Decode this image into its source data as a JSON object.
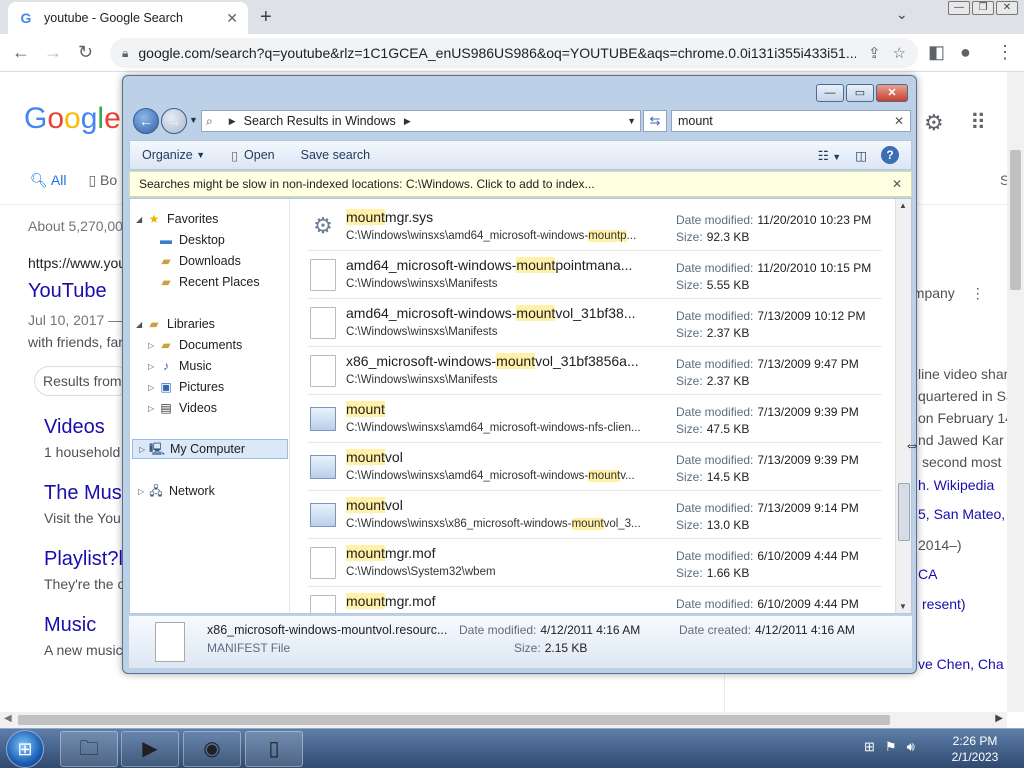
{
  "browser": {
    "tab_title": "youtube - Google Search",
    "tab_favicon": "G",
    "url": "google.com/search?q=youtube&rlz=1C1GCEA_enUS986US986&oq=YOUTUBE&aqs=chrome.0.0i131i355i433i51..."
  },
  "google": {
    "logo": "Google",
    "tab_all": "All",
    "tab_books": "Bo",
    "tab_more": "S",
    "stats": "About 5,270,00",
    "result_url": "https://www.you",
    "result_title": "YouTube",
    "result_date": "Jul 10, 2017  —",
    "result_snip": "with friends, far",
    "results_from": "Results from",
    "sub1_title": "Videos",
    "sub1_snip": "1 household",
    "sub2_title": "The Mus",
    "sub2_snip": "Visit the You",
    "sub3_title": "Playlist?l",
    "sub3_snip": "They're the c",
    "sub4_title": "Music",
    "sub4_snip": "A new music",
    "kp_company": "ompany",
    "kp_l1": "line video shar",
    "kp_l2": "quartered in Sa",
    "kp_l3": "on February 14",
    "kp_l4": "nd Jawed Kar",
    "kp_l5": "second most",
    "kp_wiki": "h. Wikipedia",
    "kp_l6": "5, San Mateo,",
    "kp_l7": "2014–)",
    "kp_l8": "CA",
    "kp_l9": "resent)",
    "kp_l10": "ve Chen, Cha"
  },
  "explorer": {
    "breadcrumb": "Search Results in Windows",
    "search_value": "mount",
    "commands": {
      "organize": "Organize",
      "open": "Open",
      "save_search": "Save search"
    },
    "infobar": "Searches might be slow in non-indexed locations: C:\\Windows. Click to add to index...",
    "nav": {
      "favorites": "Favorites",
      "desktop": "Desktop",
      "downloads": "Downloads",
      "recent": "Recent Places",
      "libraries": "Libraries",
      "documents": "Documents",
      "music": "Music",
      "pictures": "Pictures",
      "videos": "Videos",
      "computer": "My Computer",
      "network": "Network"
    },
    "labels": {
      "date_modified": "Date modified:",
      "size": "Size:",
      "date_created": "Date created:"
    },
    "files": [
      {
        "pre": "",
        "hl": "mount",
        "post": "mgr.sys",
        "path_pre": "C:\\Windows\\winsxs\\amd64_microsoft-windows-",
        "path_hl": "mountp",
        "path_post": "...",
        "date": "11/20/2010 10:23 PM",
        "size": "92.3 KB",
        "icon": "gear"
      },
      {
        "pre": "amd64_microsoft-windows-",
        "hl": "mount",
        "post": "pointmana...",
        "path_pre": "C:\\Windows\\winsxs\\Manifests",
        "path_hl": "",
        "path_post": "",
        "date": "11/20/2010 10:15 PM",
        "size": "5.55 KB",
        "icon": "doc"
      },
      {
        "pre": "amd64_microsoft-windows-",
        "hl": "mount",
        "post": "vol_31bf38...",
        "path_pre": "C:\\Windows\\winsxs\\Manifests",
        "path_hl": "",
        "path_post": "",
        "date": "7/13/2009 10:12 PM",
        "size": "2.37 KB",
        "icon": "doc"
      },
      {
        "pre": "x86_microsoft-windows-",
        "hl": "mount",
        "post": "vol_31bf3856a...",
        "path_pre": "C:\\Windows\\winsxs\\Manifests",
        "path_hl": "",
        "path_post": "",
        "date": "7/13/2009 9:47 PM",
        "size": "2.37 KB",
        "icon": "doc"
      },
      {
        "pre": "",
        "hl": "mount",
        "post": "",
        "path_pre": "C:\\Windows\\winsxs\\amd64_microsoft-windows-nfs-clien...",
        "path_hl": "",
        "path_post": "",
        "date": "7/13/2009 9:39 PM",
        "size": "47.5 KB",
        "icon": "app"
      },
      {
        "pre": "",
        "hl": "mount",
        "post": "vol",
        "path_pre": "C:\\Windows\\winsxs\\amd64_microsoft-windows-",
        "path_hl": "mount",
        "path_post": "v...",
        "date": "7/13/2009 9:39 PM",
        "size": "14.5 KB",
        "icon": "app"
      },
      {
        "pre": "",
        "hl": "mount",
        "post": "vol",
        "path_pre": "C:\\Windows\\winsxs\\x86_microsoft-windows-",
        "path_hl": "mount",
        "path_post": "vol_3...",
        "date": "7/13/2009 9:14 PM",
        "size": "13.0 KB",
        "icon": "app"
      },
      {
        "pre": "",
        "hl": "mount",
        "post": "mgr.mof",
        "path_pre": "C:\\Windows\\System32\\wbem",
        "path_hl": "",
        "path_post": "",
        "date": "6/10/2009 4:44 PM",
        "size": "1.66 KB",
        "icon": "doc"
      },
      {
        "pre": "",
        "hl": "mount",
        "post": "mgr.mof",
        "path_pre": "",
        "path_hl": "",
        "path_post": "",
        "date": "6/10/2009 4:44 PM",
        "size": "",
        "icon": "doc"
      }
    ],
    "details": {
      "name": "x86_microsoft-windows-mountvol.resourc...",
      "type": "MANIFEST File",
      "date_modified": "4/12/2011 4:16 AM",
      "size": "2.15 KB",
      "date_created": "4/12/2011 4:16 AM"
    }
  },
  "taskbar": {
    "time": "2:26 PM",
    "date": "2/1/2023"
  }
}
